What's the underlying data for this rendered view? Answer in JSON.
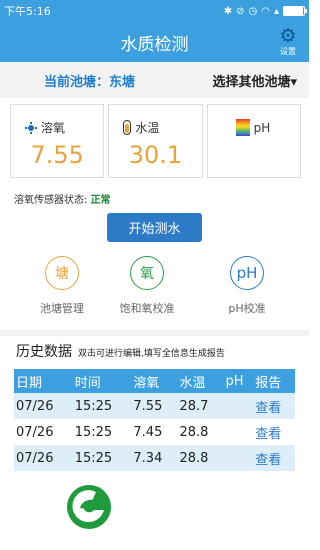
{
  "status": {
    "time": "下午5:16",
    "icons": [
      "bluetooth-icon",
      "mute-icon",
      "alarm-icon",
      "wifi-icon",
      "signal-icon",
      "battery-icon"
    ],
    "battery_level": 0.95
  },
  "header": {
    "title": "水质检测",
    "settings_label": "设置"
  },
  "pond": {
    "current": "当前池塘：东塘",
    "select": "选择其他池塘▾"
  },
  "cards": [
    {
      "label": "溶氧",
      "value": "7.55",
      "icon": "oxygen-icon"
    },
    {
      "label": "水温",
      "value": "30.1",
      "icon": "thermometer-icon"
    },
    {
      "label": "pH",
      "value": "",
      "icon": "ph-scale-icon"
    }
  ],
  "sensor": {
    "label": "溶氧传感器状态:",
    "status": "正常"
  },
  "start_button": "开始测水",
  "functions": [
    {
      "glyph": "塘",
      "label": "池塘管理"
    },
    {
      "glyph": "氧",
      "label": "饱和氧校准"
    },
    {
      "glyph": "pH",
      "label": "pH校准"
    }
  ],
  "history": {
    "title": "历史数据",
    "hint": "双击可进行编辑,填写全信息生成报告",
    "columns": [
      "日期",
      "时间",
      "溶氧",
      "水温",
      "pH",
      "报告"
    ],
    "rows": [
      [
        "07/26",
        "15:25",
        "7.55",
        "28.7",
        "",
        "查看"
      ],
      [
        "07/26",
        "15:25",
        "7.45",
        "28.8",
        "",
        "查看"
      ],
      [
        "07/26",
        "15:25",
        "7.34",
        "28.8",
        "",
        "查看"
      ]
    ]
  },
  "colors": {
    "primary": "#3c9fe0",
    "button": "#2d7bc6",
    "value": "#e8a33b",
    "ok": "#1c8a3a"
  }
}
